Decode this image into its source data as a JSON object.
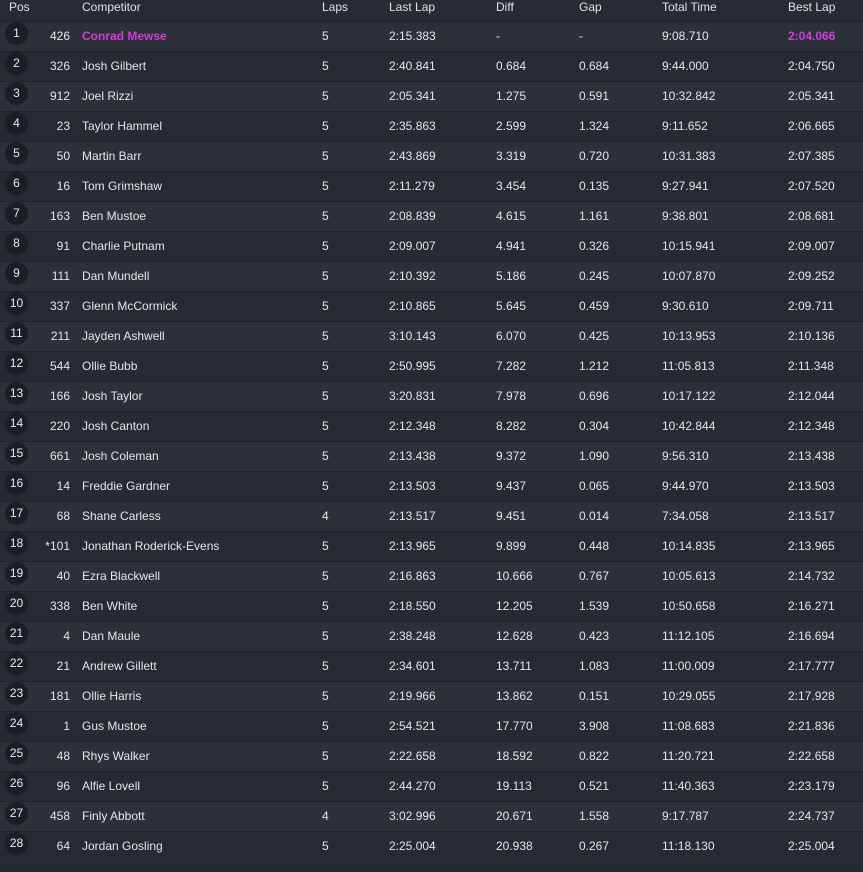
{
  "headers": {
    "pos": "Pos",
    "competitor": "Competitor",
    "laps": "Laps",
    "last_lap": "Last Lap",
    "diff": "Diff",
    "gap": "Gap",
    "total_time": "Total Time",
    "best_lap": "Best Lap"
  },
  "colors": {
    "highlight": "#d63ad9"
  },
  "rows": [
    {
      "pos": "1",
      "num": "426",
      "name": "Conrad Mewse",
      "laps": "5",
      "last": "2:15.383",
      "diff": "-",
      "gap": "-",
      "total": "9:08.710",
      "best": "2:04.066"
    },
    {
      "pos": "2",
      "num": "326",
      "name": "Josh Gilbert",
      "laps": "5",
      "last": "2:40.841",
      "diff": "0.684",
      "gap": "0.684",
      "total": "9:44.000",
      "best": "2:04.750"
    },
    {
      "pos": "3",
      "num": "912",
      "name": "Joel Rizzi",
      "laps": "5",
      "last": "2:05.341",
      "diff": "1.275",
      "gap": "0.591",
      "total": "10:32.842",
      "best": "2:05.341"
    },
    {
      "pos": "4",
      "num": "23",
      "name": "Taylor Hammel",
      "laps": "5",
      "last": "2:35.863",
      "diff": "2.599",
      "gap": "1.324",
      "total": "9:11.652",
      "best": "2:06.665"
    },
    {
      "pos": "5",
      "num": "50",
      "name": "Martin Barr",
      "laps": "5",
      "last": "2:43.869",
      "diff": "3.319",
      "gap": "0.720",
      "total": "10:31.383",
      "best": "2:07.385"
    },
    {
      "pos": "6",
      "num": "16",
      "name": "Tom Grimshaw",
      "laps": "5",
      "last": "2:11.279",
      "diff": "3.454",
      "gap": "0.135",
      "total": "9:27.941",
      "best": "2:07.520"
    },
    {
      "pos": "7",
      "num": "163",
      "name": "Ben Mustoe",
      "laps": "5",
      "last": "2:08.839",
      "diff": "4.615",
      "gap": "1.161",
      "total": "9:38.801",
      "best": "2:08.681"
    },
    {
      "pos": "8",
      "num": "91",
      "name": "Charlie Putnam",
      "laps": "5",
      "last": "2:09.007",
      "diff": "4.941",
      "gap": "0.326",
      "total": "10:15.941",
      "best": "2:09.007"
    },
    {
      "pos": "9",
      "num": "111",
      "name": "Dan Mundell",
      "laps": "5",
      "last": "2:10.392",
      "diff": "5.186",
      "gap": "0.245",
      "total": "10:07.870",
      "best": "2:09.252"
    },
    {
      "pos": "10",
      "num": "337",
      "name": "Glenn McCormick",
      "laps": "5",
      "last": "2:10.865",
      "diff": "5.645",
      "gap": "0.459",
      "total": "9:30.610",
      "best": "2:09.711"
    },
    {
      "pos": "11",
      "num": "211",
      "name": "Jayden Ashwell",
      "laps": "5",
      "last": "3:10.143",
      "diff": "6.070",
      "gap": "0.425",
      "total": "10:13.953",
      "best": "2:10.136"
    },
    {
      "pos": "12",
      "num": "544",
      "name": "Ollie Bubb",
      "laps": "5",
      "last": "2:50.995",
      "diff": "7.282",
      "gap": "1.212",
      "total": "11:05.813",
      "best": "2:11.348"
    },
    {
      "pos": "13",
      "num": "166",
      "name": "Josh Taylor",
      "laps": "5",
      "last": "3:20.831",
      "diff": "7.978",
      "gap": "0.696",
      "total": "10:17.122",
      "best": "2:12.044"
    },
    {
      "pos": "14",
      "num": "220",
      "name": "Josh Canton",
      "laps": "5",
      "last": "2:12.348",
      "diff": "8.282",
      "gap": "0.304",
      "total": "10:42.844",
      "best": "2:12.348"
    },
    {
      "pos": "15",
      "num": "661",
      "name": "Josh Coleman",
      "laps": "5",
      "last": "2:13.438",
      "diff": "9.372",
      "gap": "1.090",
      "total": "9:56.310",
      "best": "2:13.438"
    },
    {
      "pos": "16",
      "num": "14",
      "name": "Freddie Gardner",
      "laps": "5",
      "last": "2:13.503",
      "diff": "9.437",
      "gap": "0.065",
      "total": "9:44.970",
      "best": "2:13.503"
    },
    {
      "pos": "17",
      "num": "68",
      "name": "Shane Carless",
      "laps": "4",
      "last": "2:13.517",
      "diff": "9.451",
      "gap": "0.014",
      "total": "7:34.058",
      "best": "2:13.517"
    },
    {
      "pos": "18",
      "num": "*101",
      "name": "Jonathan Roderick-Evens",
      "laps": "5",
      "last": "2:13.965",
      "diff": "9.899",
      "gap": "0.448",
      "total": "10:14.835",
      "best": "2:13.965"
    },
    {
      "pos": "19",
      "num": "40",
      "name": "Ezra Blackwell",
      "laps": "5",
      "last": "2:16.863",
      "diff": "10.666",
      "gap": "0.767",
      "total": "10:05.613",
      "best": "2:14.732"
    },
    {
      "pos": "20",
      "num": "338",
      "name": "Ben White",
      "laps": "5",
      "last": "2:18.550",
      "diff": "12.205",
      "gap": "1.539",
      "total": "10:50.658",
      "best": "2:16.271"
    },
    {
      "pos": "21",
      "num": "4",
      "name": "Dan Maule",
      "laps": "5",
      "last": "2:38.248",
      "diff": "12.628",
      "gap": "0.423",
      "total": "11:12.105",
      "best": "2:16.694"
    },
    {
      "pos": "22",
      "num": "21",
      "name": "Andrew Gillett",
      "laps": "5",
      "last": "2:34.601",
      "diff": "13.711",
      "gap": "1.083",
      "total": "11:00.009",
      "best": "2:17.777"
    },
    {
      "pos": "23",
      "num": "181",
      "name": "Ollie Harris",
      "laps": "5",
      "last": "2:19.966",
      "diff": "13.862",
      "gap": "0.151",
      "total": "10:29.055",
      "best": "2:17.928"
    },
    {
      "pos": "24",
      "num": "1",
      "name": "Gus Mustoe",
      "laps": "5",
      "last": "2:54.521",
      "diff": "17.770",
      "gap": "3.908",
      "total": "11:08.683",
      "best": "2:21.836"
    },
    {
      "pos": "25",
      "num": "48",
      "name": "Rhys Walker",
      "laps": "5",
      "last": "2:22.658",
      "diff": "18.592",
      "gap": "0.822",
      "total": "11:20.721",
      "best": "2:22.658"
    },
    {
      "pos": "26",
      "num": "96",
      "name": "Alfie Lovell",
      "laps": "5",
      "last": "2:44.270",
      "diff": "19.113",
      "gap": "0.521",
      "total": "11:40.363",
      "best": "2:23.179"
    },
    {
      "pos": "27",
      "num": "458",
      "name": "Finly Abbott",
      "laps": "4",
      "last": "3:02.996",
      "diff": "20.671",
      "gap": "1.558",
      "total": "9:17.787",
      "best": "2:24.737"
    },
    {
      "pos": "28",
      "num": "64",
      "name": "Jordan Gosling",
      "laps": "5",
      "last": "2:25.004",
      "diff": "20.938",
      "gap": "0.267",
      "total": "11:18.130",
      "best": "2:25.004"
    }
  ]
}
